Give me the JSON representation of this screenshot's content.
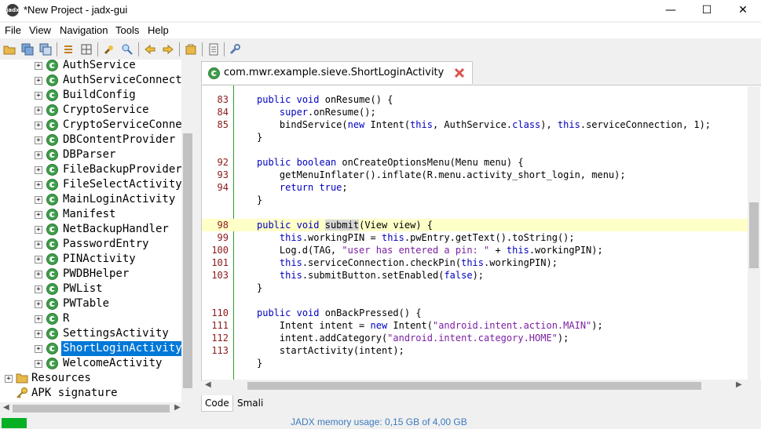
{
  "window": {
    "title": "*New Project - jadx-gui",
    "app_icon_label": "jadx",
    "minimize": "—",
    "maximize": "☐",
    "close": "✕"
  },
  "menu": [
    "File",
    "View",
    "Navigation",
    "Tools",
    "Help"
  ],
  "tree": {
    "items": [
      {
        "label": "AuthService",
        "selected": false
      },
      {
        "label": "AuthServiceConnecto",
        "selected": false
      },
      {
        "label": "BuildConfig",
        "selected": false
      },
      {
        "label": "CryptoService",
        "selected": false
      },
      {
        "label": "CryptoServiceConnec",
        "selected": false
      },
      {
        "label": "DBContentProvider",
        "selected": false
      },
      {
        "label": "DBParser",
        "selected": false
      },
      {
        "label": "FileBackupProvider",
        "selected": false
      },
      {
        "label": "FileSelectActivity",
        "selected": false
      },
      {
        "label": "MainLoginActivity",
        "selected": false
      },
      {
        "label": "Manifest",
        "selected": false
      },
      {
        "label": "NetBackupHandler",
        "selected": false
      },
      {
        "label": "PasswordEntry",
        "selected": false
      },
      {
        "label": "PINActivity",
        "selected": false
      },
      {
        "label": "PWDBHelper",
        "selected": false
      },
      {
        "label": "PWList",
        "selected": false
      },
      {
        "label": "PWTable",
        "selected": false
      },
      {
        "label": "R",
        "selected": false
      },
      {
        "label": "SettingsActivity",
        "selected": false
      },
      {
        "label": "ShortLoginActivity",
        "selected": true
      },
      {
        "label": "WelcomeActivity",
        "selected": false
      }
    ],
    "resources_label": "Resources",
    "apk_signature_label": "APK signature"
  },
  "editor": {
    "tab_title": "com.mwr.example.sieve.ShortLoginActivity",
    "lines": [
      {
        "n": "83",
        "code": "public void onResume() {",
        "hl": false
      },
      {
        "n": "84",
        "code": "    super.onResume();",
        "hl": false
      },
      {
        "n": "85",
        "code": "    bindService(new Intent(this, AuthService.class), this.serviceConnection, 1);",
        "hl": false
      },
      {
        "n": "",
        "code": "}",
        "hl": false
      },
      {
        "n": "",
        "code": "",
        "hl": false
      },
      {
        "n": "92",
        "code": "public boolean onCreateOptionsMenu(Menu menu) {",
        "hl": false
      },
      {
        "n": "93",
        "code": "    getMenuInflater().inflate(R.menu.activity_short_login, menu);",
        "hl": false
      },
      {
        "n": "94",
        "code": "    return true;",
        "hl": false
      },
      {
        "n": "",
        "code": "}",
        "hl": false
      },
      {
        "n": "",
        "code": "",
        "hl": false
      },
      {
        "n": "98",
        "code": "public void submit(View view) {",
        "hl": true
      },
      {
        "n": "99",
        "code": "    this.workingPIN = this.pwEntry.getText().toString();",
        "hl": false
      },
      {
        "n": "100",
        "code": "    Log.d(TAG, \"user has entered a pin: \" + this.workingPIN);",
        "hl": false
      },
      {
        "n": "101",
        "code": "    this.serviceConnection.checkPin(this.workingPIN);",
        "hl": false
      },
      {
        "n": "103",
        "code": "    this.submitButton.setEnabled(false);",
        "hl": false
      },
      {
        "n": "",
        "code": "}",
        "hl": false
      },
      {
        "n": "",
        "code": "",
        "hl": false
      },
      {
        "n": "110",
        "code": "public void onBackPressed() {",
        "hl": false
      },
      {
        "n": "111",
        "code": "    Intent intent = new Intent(\"android.intent.action.MAIN\");",
        "hl": false
      },
      {
        "n": "112",
        "code": "    intent.addCategory(\"android.intent.category.HOME\");",
        "hl": false
      },
      {
        "n": "113",
        "code": "    startActivity(intent);",
        "hl": false
      },
      {
        "n": "",
        "code": "}",
        "hl": false
      }
    ],
    "bottom_tabs": [
      "Code",
      "Smali"
    ],
    "active_bottom_tab": "Code"
  },
  "status": {
    "memory": "JADX memory usage: 0,15 GB of 4,00 GB",
    "memory_fraction": 0.0375
  },
  "colors": {
    "keyword": "#0000c0",
    "string": "#7b1fa2",
    "line_number": "#8b1a1a",
    "highlight": "#ffffc8",
    "selection": "#0078d7",
    "memory_bar": "#06b025"
  }
}
